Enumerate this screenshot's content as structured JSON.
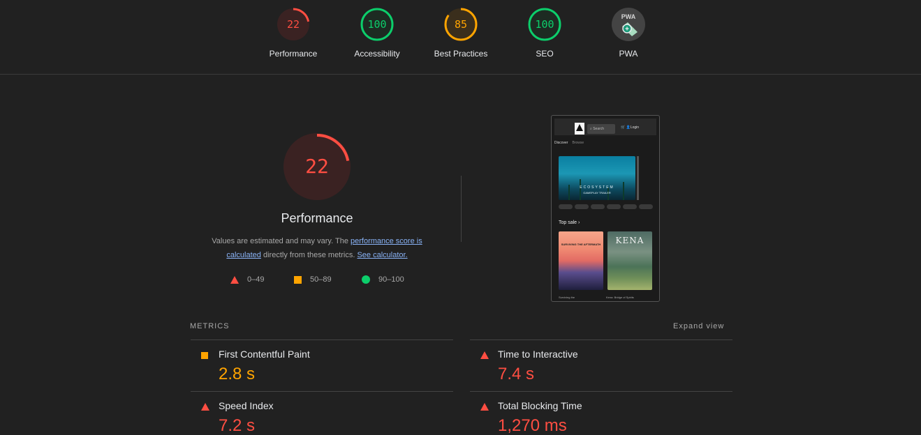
{
  "colors": {
    "fail": "#ff4e42",
    "average": "#ffa400",
    "pass": "#0cce6b",
    "background": "#212121"
  },
  "categories": [
    {
      "score": "22",
      "label": "Performance",
      "status": "fail",
      "fraction": 0.22
    },
    {
      "score": "100",
      "label": "Accessibility",
      "status": "pass",
      "fraction": 1.0
    },
    {
      "score": "85",
      "label": "Best Practices",
      "status": "average",
      "fraction": 0.85
    },
    {
      "score": "100",
      "label": "SEO",
      "status": "pass",
      "fraction": 1.0
    },
    {
      "score": "PWA",
      "label": "PWA",
      "status": "pwa-badge",
      "icon": "pwa-badge-icon"
    }
  ],
  "performance": {
    "score": "22",
    "fraction": 0.22,
    "title": "Performance",
    "desc_prefix": "Values are estimated and may vary. The",
    "desc_link1": "performance score is calculated",
    "desc_middle": "directly from these metrics.",
    "desc_link2": "See calculator."
  },
  "legend": [
    {
      "shape": "triangle",
      "range": "0–49"
    },
    {
      "shape": "square",
      "range": "50–89"
    },
    {
      "shape": "circle",
      "range": "90–100"
    }
  ],
  "thumbnail": {
    "search": "Search",
    "login": "Login",
    "tab_discover": "Discover",
    "tab_browse": "Browse",
    "hero_title": "ECOSYSTEM",
    "hero_subtitle": "GAMEPLAY TRAILER",
    "top_sale": "Top sale",
    "card1_title": "SURVIVING THE AFTERMATH",
    "card2_title": "KENA",
    "caption1": "Surviving the",
    "caption2": "Kena: Bridge of Spirits"
  },
  "metrics": {
    "heading": "METRICS",
    "expand_label": "Expand view",
    "items": [
      {
        "name": "First Contentful Paint",
        "value": "2.8 s",
        "status": "average"
      },
      {
        "name": "Time to Interactive",
        "value": "7.4 s",
        "status": "fail"
      },
      {
        "name": "Speed Index",
        "value": "7.2 s",
        "status": "fail"
      },
      {
        "name": "Total Blocking Time",
        "value": "1,270 ms",
        "status": "fail"
      }
    ]
  }
}
